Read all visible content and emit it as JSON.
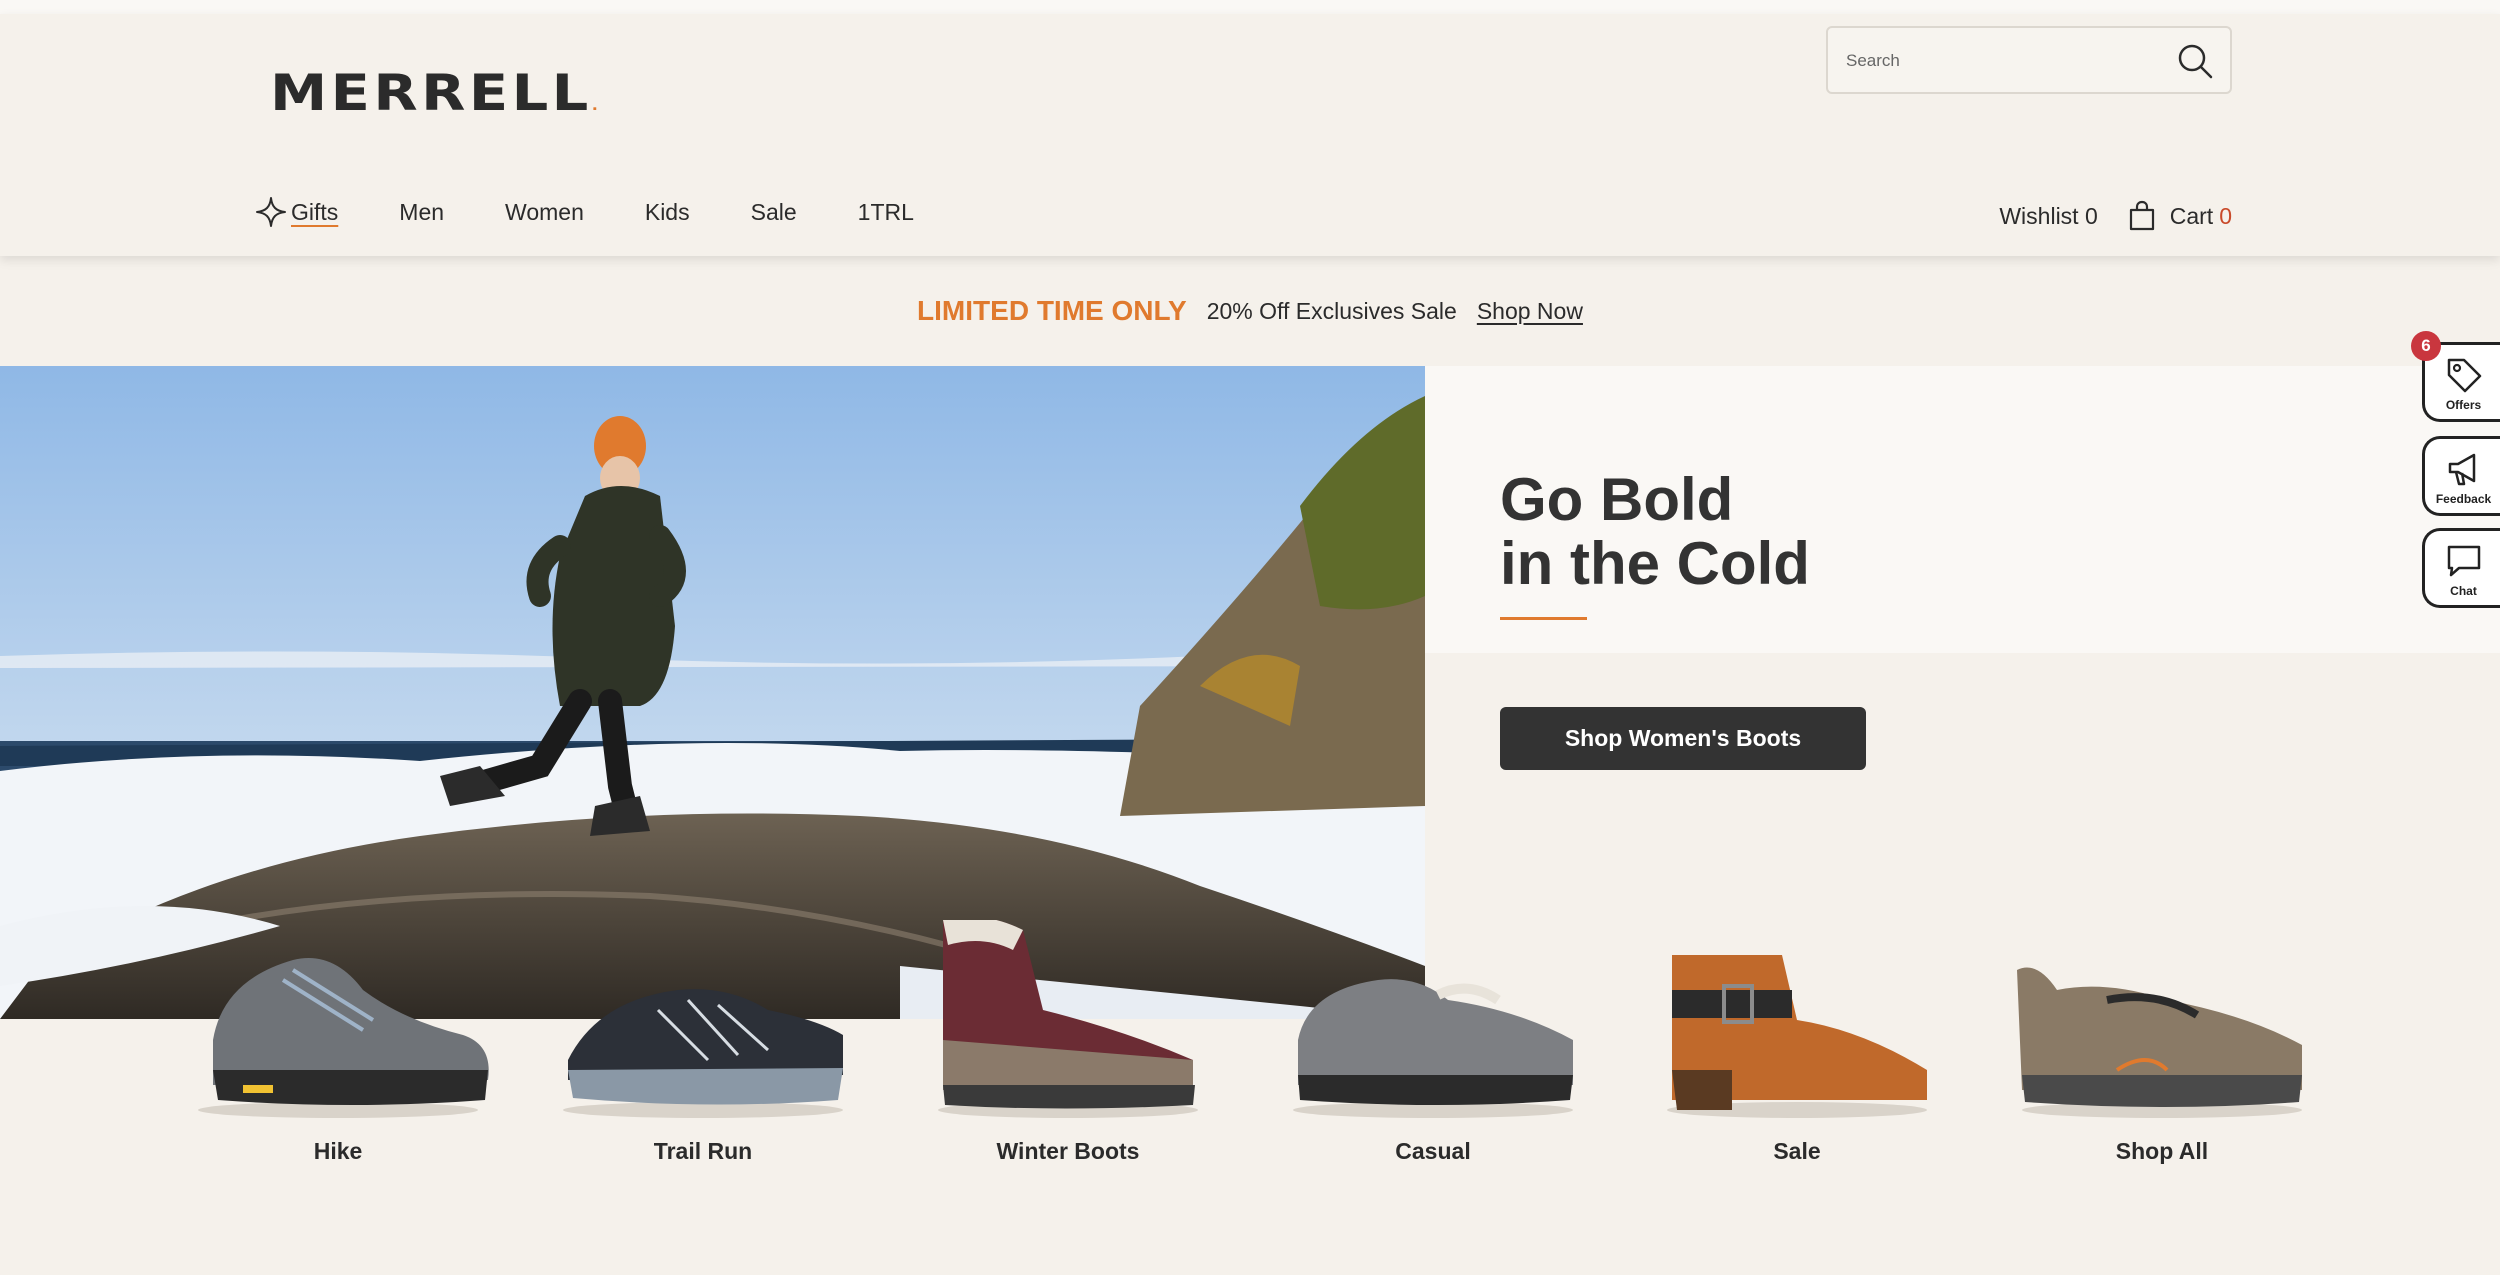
{
  "header": {
    "logo": "MERRELL",
    "logo_mark": ".",
    "search": {
      "placeholder": "Search"
    }
  },
  "nav": {
    "items": [
      {
        "label": "Gifts"
      },
      {
        "label": "Men"
      },
      {
        "label": "Women"
      },
      {
        "label": "Kids"
      },
      {
        "label": "Sale"
      },
      {
        "label": "1TRL"
      }
    ]
  },
  "account": {
    "wishlist_label": "Wishlist 0",
    "cart_label": "Cart",
    "cart_count": "0"
  },
  "promo": {
    "highlight": "LIMITED TIME ONLY",
    "offer": "20% Off Exclusives Sale",
    "link": "Shop Now"
  },
  "hero": {
    "headline_line1": "Go Bold",
    "headline_line2": "in the Cold",
    "cta": "Shop Women's Boots"
  },
  "categories": [
    {
      "label": "Hike",
      "icon": "hiking-shoe"
    },
    {
      "label": "Trail Run",
      "icon": "trail-running-shoe"
    },
    {
      "label": "Winter Boots",
      "icon": "winter-boot"
    },
    {
      "label": "Casual",
      "icon": "casual-clog"
    },
    {
      "label": "Sale",
      "icon": "ankle-boot"
    },
    {
      "label": "Shop All",
      "icon": "slip-on-shoe"
    }
  ],
  "side_tabs": {
    "offers_label": "Offers",
    "offers_count": "6",
    "feedback_label": "Feedback",
    "chat_label": "Chat"
  },
  "colors": {
    "background": "#f5f1eb",
    "accent": "#e07a2e",
    "cta": "#333333",
    "cart_count": "#c94a2a",
    "badge": "#c9363e"
  }
}
